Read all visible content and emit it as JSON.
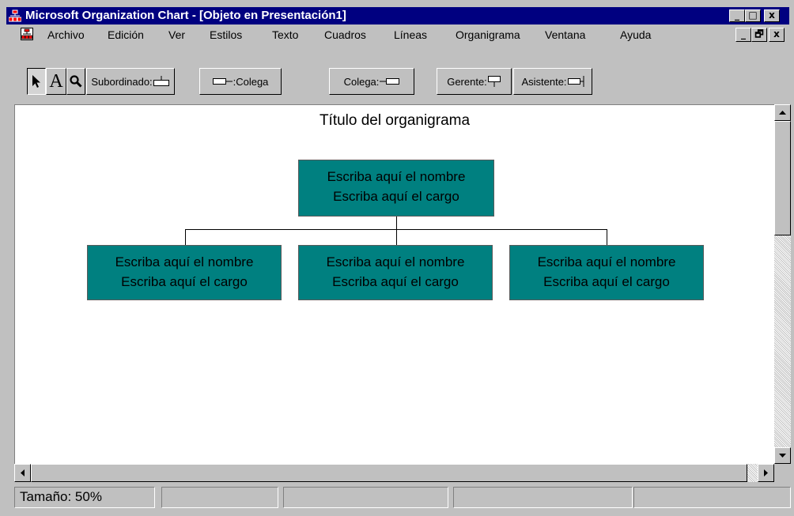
{
  "window": {
    "title": "Microsoft Organization Chart - [Objeto en Presentación1]",
    "caption_buttons": [
      "_",
      "□",
      "x"
    ],
    "mdi_buttons": [
      "_",
      "🗗",
      "x"
    ]
  },
  "menu": {
    "items": [
      {
        "label": "Archivo"
      },
      {
        "label": "Edición"
      },
      {
        "label": "Ver"
      },
      {
        "label": "Estilos"
      },
      {
        "label": "Texto"
      },
      {
        "label": "Cuadros"
      },
      {
        "label": "Líneas"
      },
      {
        "label": "Organigrama"
      },
      {
        "label": "Ventana"
      },
      {
        "label": "Ayuda"
      }
    ]
  },
  "toolbar": {
    "select_tool_icon": "arrow-pointer-icon",
    "text_tool_label": "A",
    "zoom_tool_icon": "magnifier-icon",
    "subordinate_label": "Subordinado:",
    "colleague_left_label": ":Colega",
    "colleague_right_label": "Colega:",
    "manager_label": "Gerente:",
    "assistant_label": "Asistente:"
  },
  "chart": {
    "title": "Título del organigrama",
    "top_box": {
      "name": "Escriba aquí el nombre",
      "role": "Escriba aquí el cargo"
    },
    "subordinates": [
      {
        "name": "Escriba aquí el nombre",
        "role": "Escriba aquí el cargo"
      },
      {
        "name": "Escriba aquí el nombre",
        "role": "Escriba aquí el cargo"
      },
      {
        "name": "Escriba aquí el nombre",
        "role": "Escriba aquí el cargo"
      }
    ],
    "box_color": "#008080"
  },
  "status": {
    "zoom": "Tamaño: 50%",
    "panel2": "",
    "panel3": "",
    "panel4": "",
    "panel5": ""
  },
  "colors": {
    "title_bar": "#000080",
    "window_bg": "#c0c0c0",
    "canvas_bg": "#ffffff"
  }
}
